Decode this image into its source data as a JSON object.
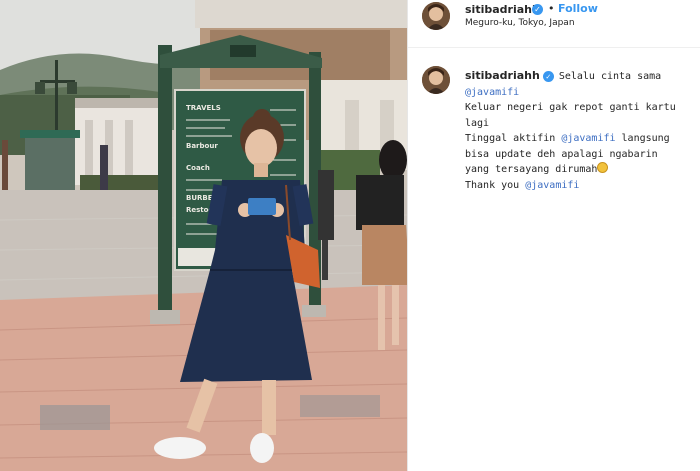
{
  "post": {
    "username": "sitibadriahh",
    "follow_label": "Follow",
    "separator": "•",
    "location": "Meguro-ku, Tokyo, Japan",
    "verified_icon": "verified-badge-icon"
  },
  "caption": {
    "username": "sitibadriahh",
    "first_line_text": "Selalu cinta sama",
    "mention_1": "@javamifi",
    "line_3": "Keluar negeri gak repot ganti kartu",
    "line_4": "lagi",
    "line_5_pre": "Tinggal aktifin ",
    "mention_2": "@javamifi",
    "line_5_post": " langsung",
    "line_6": "bisa update deh apalagi ngabarin",
    "line_7": "yang tersayang dirumah",
    "emoji_icon": "smiling-face-emoji",
    "line_8_pre": "Thank you ",
    "mention_3": "@javamifi"
  },
  "photo": {
    "sign_lines": [
      "TRAVELS",
      "Barbour",
      "Coach",
      "BURBERRY",
      "Restock"
    ]
  },
  "colors": {
    "link_blue": "#3897f0",
    "mention_blue": "#3d6ec2",
    "text": "#262626"
  }
}
